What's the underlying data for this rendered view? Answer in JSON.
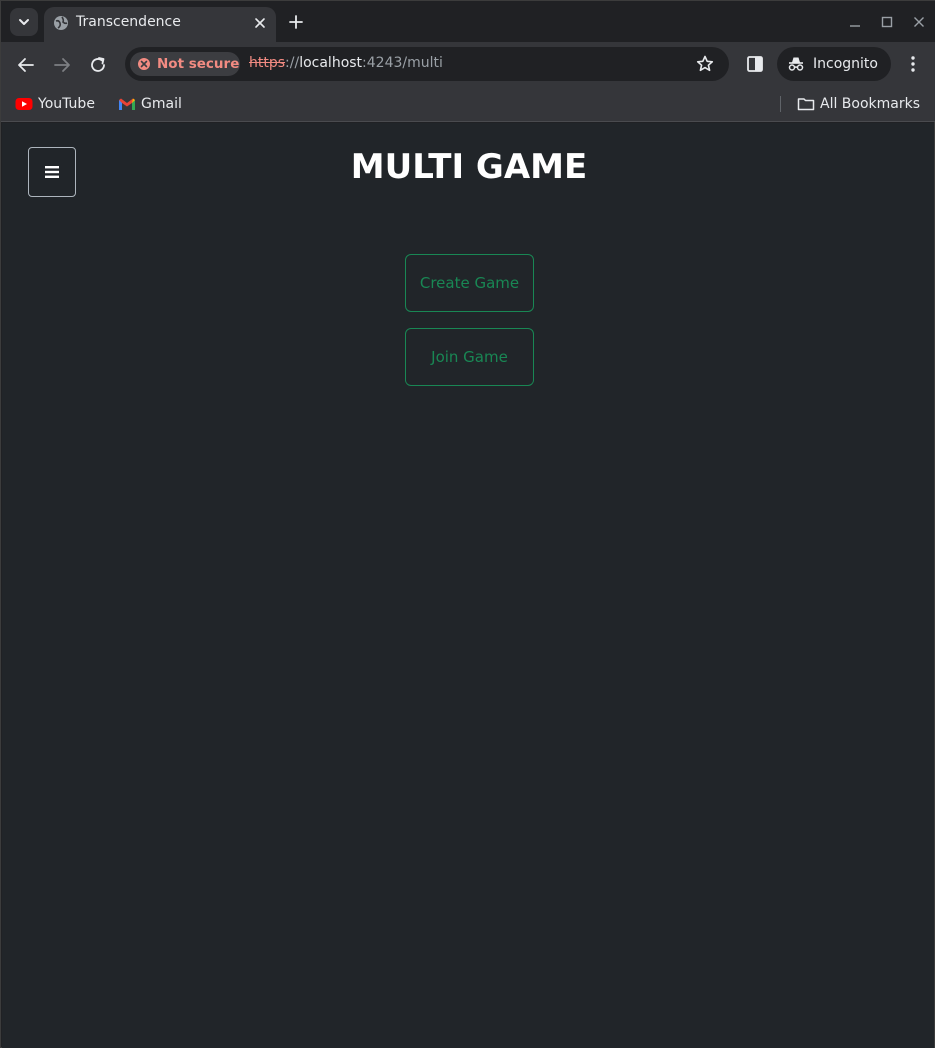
{
  "browser": {
    "tab": {
      "title": "Transcendence"
    },
    "address": {
      "security_chip": "Not secure",
      "url_scheme": "https",
      "url_sep": "://",
      "url_host": "localhost",
      "url_rest": ":4243/multi"
    },
    "profile": {
      "label": "Incognito"
    },
    "bookmarks": [
      {
        "label": "YouTube",
        "icon": "youtube-icon"
      },
      {
        "label": "Gmail",
        "icon": "gmail-icon"
      }
    ],
    "all_bookmarks": {
      "label": "All Bookmarks",
      "icon": "folder-icon"
    }
  },
  "page": {
    "title": "MULTI GAME",
    "menu_icon": "hamburger-icon",
    "buttons": {
      "create": "Create Game",
      "join": "Join Game"
    },
    "colors": {
      "background": "#212529",
      "accent": "#198754",
      "title": "#ffffff"
    }
  }
}
